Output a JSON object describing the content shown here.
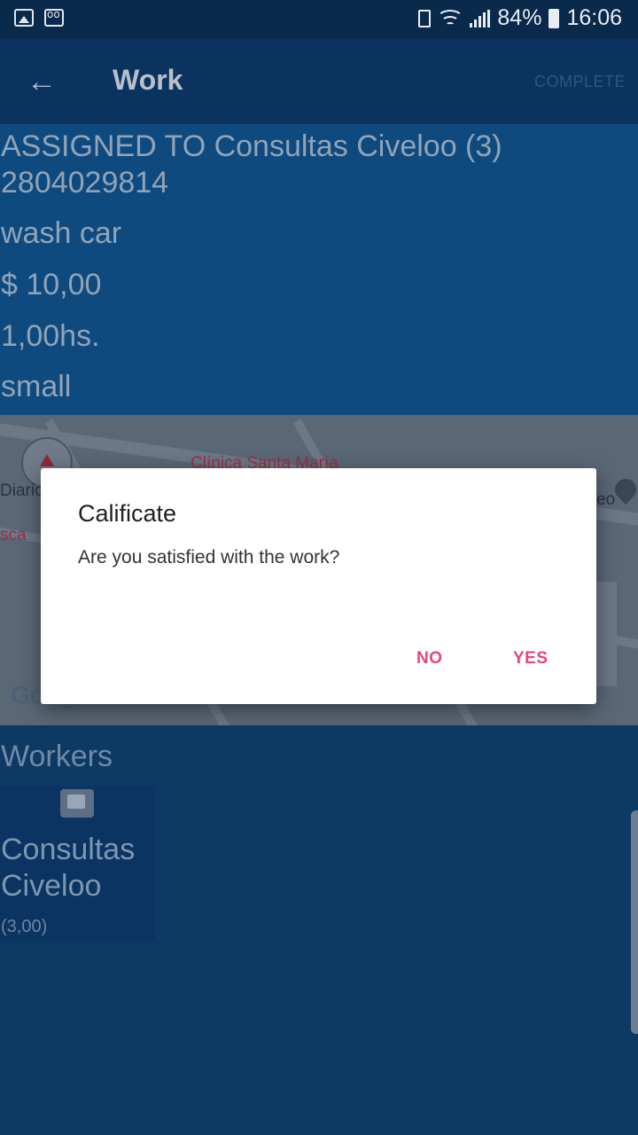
{
  "status_bar": {
    "battery": "84%",
    "time": "16:06"
  },
  "app_bar": {
    "title": "Work",
    "action": "COMPLETE"
  },
  "info": {
    "assigned": "ASSIGNED TO Consultas Civeloo (3)",
    "phone": "2804029814",
    "description": "wash car",
    "price": "$ 10,00",
    "duration": "1,00hs.",
    "size": "small"
  },
  "map": {
    "labels": [
      "Clínica Santa María",
      "Diario",
      "sca",
      "eo"
    ],
    "logo": "Google"
  },
  "workers": {
    "title": "Workers",
    "items": [
      {
        "name": "Consultas Civeloo",
        "rating": "(3,00)"
      }
    ]
  },
  "dialog": {
    "title": "Calificate",
    "message": "Are you satisfied with the work?",
    "no_label": "NO",
    "yes_label": "YES",
    "accent_color": "#e8457e"
  }
}
